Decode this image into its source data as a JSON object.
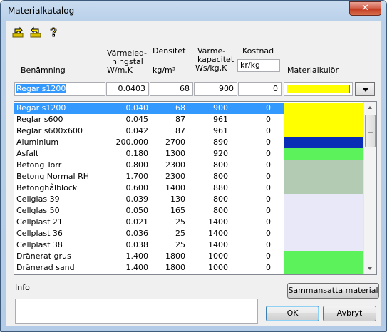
{
  "window": {
    "title": "Materialkatalog",
    "close_label": "✕"
  },
  "toolbar": {
    "icons": [
      "import-icon",
      "export-icon",
      "help-icon"
    ]
  },
  "headers": {
    "name": "Benämning",
    "conductivity_l1": "Värmeled-",
    "conductivity_l2": "ningstal",
    "conductivity_l3": "W/m,K",
    "density_l1": "Densitet",
    "density_l2": "kg/m³",
    "heatcap_l1": "Värme-",
    "heatcap_l2": "kapacitet",
    "heatcap_l3": "Ws/kg,K",
    "cost_l1": "Kostnad",
    "cost_unit": "kr/kg",
    "color": "Materialkulör"
  },
  "edit": {
    "name": "Regar s1200",
    "conductivity": "0.0403",
    "density": "68",
    "heatcap": "900",
    "cost": "0",
    "color": "#ffff00"
  },
  "materials": [
    {
      "name": "Regar s1200",
      "k": "0.040",
      "d": "68",
      "c": "900",
      "cost": "0",
      "color": "#ffff00",
      "selected": true
    },
    {
      "name": "Reglar s600",
      "k": "0.045",
      "d": "87",
      "c": "961",
      "cost": "0",
      "color": "#ffff00"
    },
    {
      "name": "Reglar s600x600",
      "k": "0.042",
      "d": "87",
      "c": "961",
      "cost": "0",
      "color": "#ffff00"
    },
    {
      "name": "Aluminium",
      "k": "200.000",
      "d": "2700",
      "c": "890",
      "cost": "0",
      "color": "#0a2db5"
    },
    {
      "name": "Asfalt",
      "k": "0.180",
      "d": "1300",
      "c": "920",
      "cost": "0",
      "color": "#5cf25c"
    },
    {
      "name": "Betong Torr",
      "k": "0.800",
      "d": "2300",
      "c": "800",
      "cost": "0",
      "color": "#b2cbb2"
    },
    {
      "name": "Betong Normal RH",
      "k": "1.700",
      "d": "2300",
      "c": "800",
      "cost": "0",
      "color": "#b2cbb2"
    },
    {
      "name": "Betonghålblock",
      "k": "0.600",
      "d": "1400",
      "c": "880",
      "cost": "0",
      "color": "#b2cbb2"
    },
    {
      "name": "Cellglas 39",
      "k": "0.039",
      "d": "130",
      "c": "800",
      "cost": "0",
      "color": "#e8e8f8"
    },
    {
      "name": "Cellglas 50",
      "k": "0.050",
      "d": "165",
      "c": "800",
      "cost": "0",
      "color": "#e8e8f8"
    },
    {
      "name": "Cellplast 21",
      "k": "0.021",
      "d": "25",
      "c": "1400",
      "cost": "0",
      "color": "#e8e8f8"
    },
    {
      "name": "Cellplast 36",
      "k": "0.036",
      "d": "25",
      "c": "1400",
      "cost": "0",
      "color": "#e8e8f8"
    },
    {
      "name": "Cellplast 38",
      "k": "0.038",
      "d": "25",
      "c": "1400",
      "cost": "0",
      "color": "#e8e8f8"
    },
    {
      "name": "Dränerat grus",
      "k": "1.400",
      "d": "1800",
      "c": "1000",
      "cost": "0",
      "color": "#5cf25c"
    },
    {
      "name": "Dränerad sand",
      "k": "1.400",
      "d": "1800",
      "c": "1000",
      "cost": "0",
      "color": "#5cf25c"
    }
  ],
  "info": {
    "label": "Info",
    "text": ""
  },
  "buttons": {
    "composite": "Sammansatta material",
    "ok": "OK",
    "cancel": "Avbryt"
  }
}
